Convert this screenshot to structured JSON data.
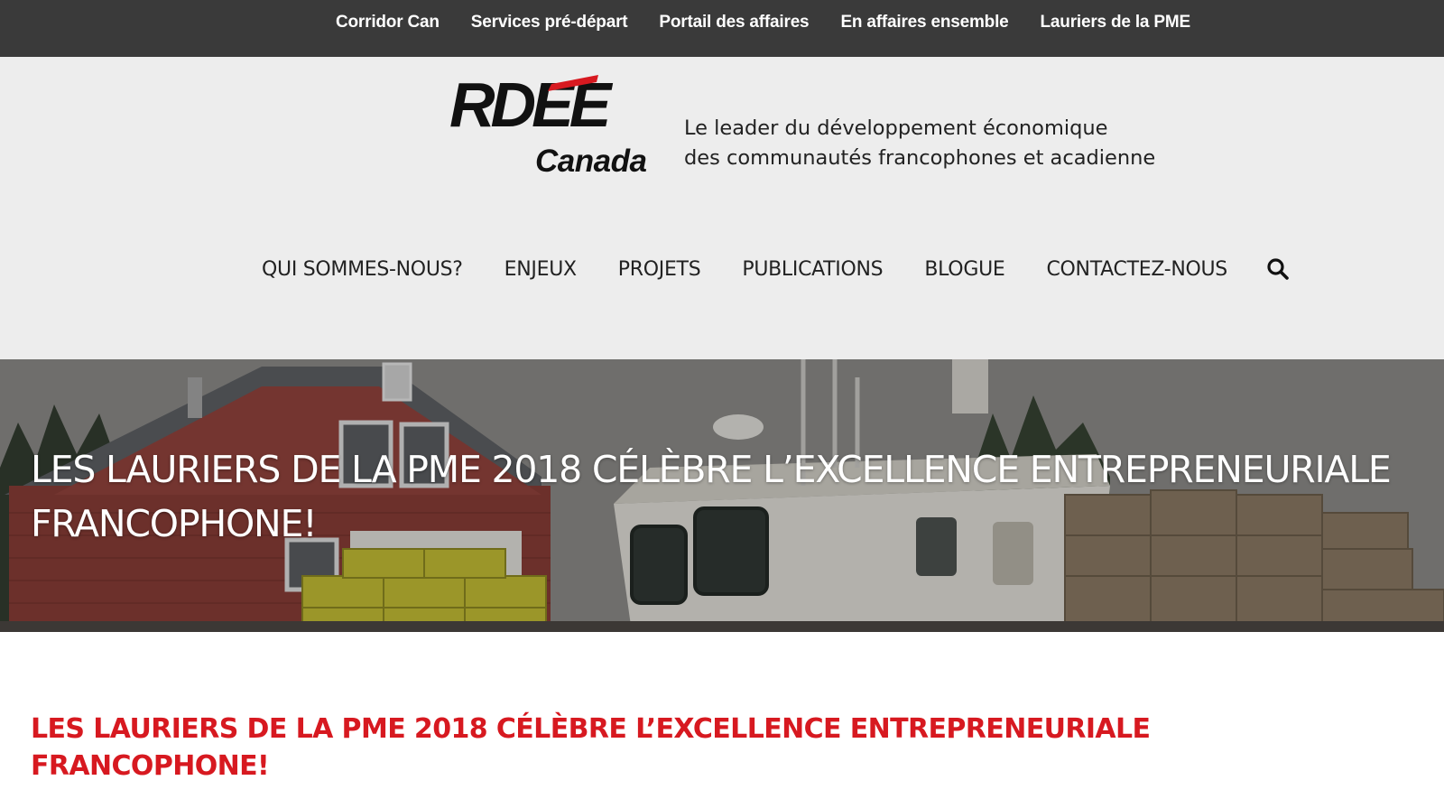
{
  "topbar": {
    "links": [
      {
        "label": "Corridor Can"
      },
      {
        "label": "Services pré-départ"
      },
      {
        "label": "Portail des affaires"
      },
      {
        "label": "En affaires ensemble"
      },
      {
        "label": "Lauriers de la PME"
      }
    ]
  },
  "header": {
    "logo": {
      "wordmark": "RDEE",
      "subtitle": "Canada"
    },
    "tagline": {
      "line1": "Le leader du développement économique",
      "line2": "des communautés francophones et acadienne"
    },
    "nav": {
      "items": [
        {
          "label": "QUI SOMMES-NOUS?"
        },
        {
          "label": "ENJEUX"
        },
        {
          "label": "PROJETS"
        },
        {
          "label": "PUBLICATIONS"
        },
        {
          "label": "BLOGUE"
        },
        {
          "label": "CONTACTEZ-NOUS"
        }
      ],
      "search_icon": "search-icon"
    }
  },
  "hero": {
    "title": "LES LAURIERS DE LA PME 2018 CÉLÈBRE L’EXCELLENCE ENTREPRENEURIALE FRANCOPHONE!"
  },
  "article": {
    "title": "LES LAURIERS DE LA PME 2018 CÉLÈBRE L’EXCELLENCE ENTREPRENEURIALE FRANCOPHONE!"
  },
  "colors": {
    "topbar_bg": "#3a3a3a",
    "header_bg": "#ededed",
    "accent_red": "#d71920",
    "text_dark": "#222222"
  }
}
